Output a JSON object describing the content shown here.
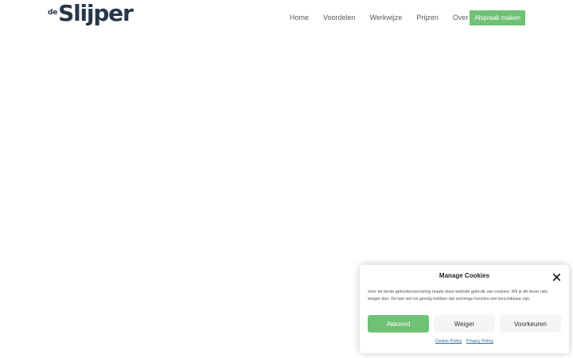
{
  "header": {
    "logo": {
      "prefix": "de",
      "word": "Slijper"
    },
    "nav": [
      {
        "label": "Home"
      },
      {
        "label": "Voordelen"
      },
      {
        "label": "Werkwijze"
      },
      {
        "label": "Prijzen"
      },
      {
        "label": "Over"
      }
    ],
    "cta_label": "Afspraak maken"
  },
  "cookie_banner": {
    "title": "Manage Cookies",
    "close_icon": "close-icon",
    "text": "Voor de beste gebruikerservaring maakt deze website gebruik van cookies. Wil je dit liever niet, weiger dan. Dit kan wel tot gevolg hebben dat sommige functies niet beschikbaar zijn.",
    "buttons": {
      "accept": "Akkoord",
      "deny": "Weiger",
      "preferences": "Voorkeuren"
    },
    "links": {
      "cookie_policy": "Cookie Policy",
      "privacy_policy": "Privacy Policy"
    }
  },
  "colors": {
    "brand_dark": "#26374a",
    "accent_green": "#6fc175",
    "link_blue": "#2a6c9a"
  }
}
